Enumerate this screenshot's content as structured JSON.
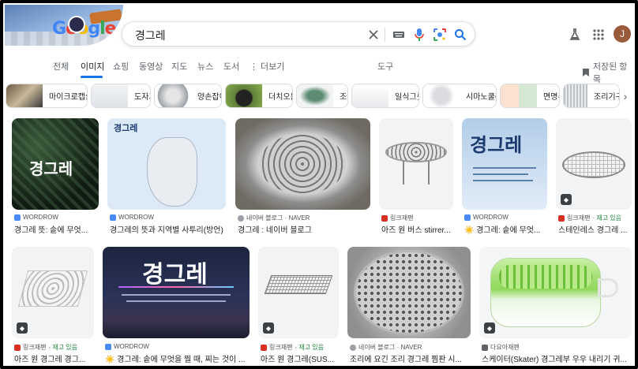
{
  "search": {
    "query": "경그레",
    "clear_icon": "close-icon",
    "keyboard_icon": "keyboard-icon",
    "mic_icon": "mic-icon",
    "lens_icon": "lens-icon",
    "search_icon": "search-icon"
  },
  "header": {
    "labs_icon": "flask-icon",
    "apps_icon": "apps-grid-icon",
    "avatar_letter": "J"
  },
  "tabs": [
    {
      "label": "전체"
    },
    {
      "label": "이미지"
    },
    {
      "label": "쇼핑"
    },
    {
      "label": "동영상"
    },
    {
      "label": "지도"
    },
    {
      "label": "뉴스"
    },
    {
      "label": "도서"
    },
    {
      "label": "⋮ 더보기"
    },
    {
      "label": "도구"
    }
  ],
  "saved_label": "저장된 항목",
  "chips": [
    {
      "label": "마이크로캡슐"
    },
    {
      "label": "도자기"
    },
    {
      "label": "양손잡이"
    },
    {
      "label": "더치오븐"
    },
    {
      "label": "조리"
    },
    {
      "label": "일식그릇"
    },
    {
      "label": "시마노쿨러"
    },
    {
      "label": "면명주"
    },
    {
      "label": "조리기구"
    }
  ],
  "results_row1": [
    {
      "source": "WORDROW",
      "title": "경그레 뜻: 솥에 무엇...",
      "img_text": "경그레"
    },
    {
      "source": "WORDROW",
      "title": "경그레의 뜻과 지역별 사투리(방언)",
      "img_text": "경그레"
    },
    {
      "source": "네이버 블로그 · NAVER",
      "title": "경그레 : 네이버 블로그"
    },
    {
      "source": "링크재팬",
      "title": "아즈 원 버스 stirrer..."
    },
    {
      "source": "WORDROW",
      "title": "☀️ 경그레: 솥에 무엇...",
      "img_text": "경그레"
    },
    {
      "source": "링크재팬",
      "stock": "· 재고 있음",
      "title": "스테인레스 경그레 ..."
    }
  ],
  "results_row2": [
    {
      "source": "링크재팬",
      "stock": "· 재고 있음",
      "title": "아즈 원 경그레 경그..."
    },
    {
      "source": "WORDROW",
      "title": "☀️ 경그레: 솥에 무엇을 찔 때, 찌는 것이 ...",
      "img_text": "경그레"
    },
    {
      "source": "링크재팬",
      "stock": "· 재고 있음",
      "title": "아즈 원 경그레(SUS..."
    },
    {
      "source": "네이버 블로그 · NAVER",
      "title": "조리에 요긴 조리 경그레 찜판 시..."
    },
    {
      "source": "다요아재팬",
      "title": "스케이터(Skater) 경그레부 우우 내리기 귀..."
    }
  ]
}
